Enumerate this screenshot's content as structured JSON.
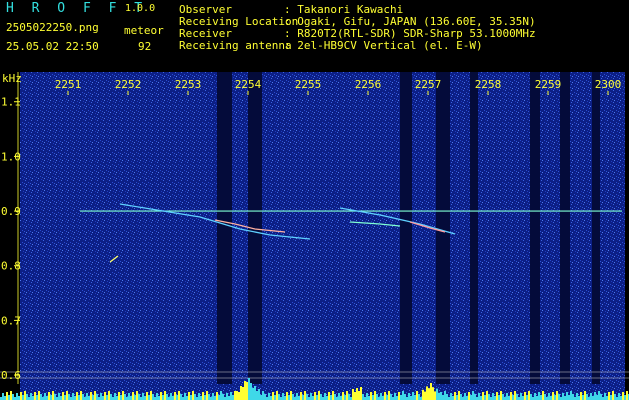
{
  "header": {
    "app_title": "H R O F F T",
    "version": "1.0.0",
    "filename": "2505022250.png",
    "meteor_label": "meteor",
    "datetime": "25.05.02 22:50",
    "meteor_count": "92",
    "info": [
      {
        "label": "Observer",
        "value": ": Takanori Kawachi"
      },
      {
        "label": "Receiving Location",
        "value": ": Ogaki, Gifu, JAPAN (136.60E, 35.35N)"
      },
      {
        "label": "Receiver",
        "value": ": R820T2(RTL-SDR) SDR-Sharp 53.1000MHz"
      },
      {
        "label": "Receiving antenna",
        "value": ": 2el-HB9CV Vertical (el. E-W)"
      }
    ]
  },
  "colors": {
    "text_yellow": "#ffff33",
    "text_cyan": "#33e0e0",
    "background": "#000000",
    "noise_blue": "#1a3fbf",
    "carrier": "#7fffd4"
  },
  "chart_data": {
    "type": "heatmap",
    "y_unit_label": "kHz",
    "x_ticks": [
      "2251",
      "2252",
      "2253",
      "2254",
      "2255",
      "2256",
      "2257",
      "2258",
      "2259",
      "2300"
    ],
    "y_ticks": [
      "1.1",
      "1.0",
      "0.9",
      "0.8",
      "0.7",
      "0.6"
    ],
    "ylim": [
      0.58,
      1.18
    ],
    "carrier_khz": 0.9
  }
}
